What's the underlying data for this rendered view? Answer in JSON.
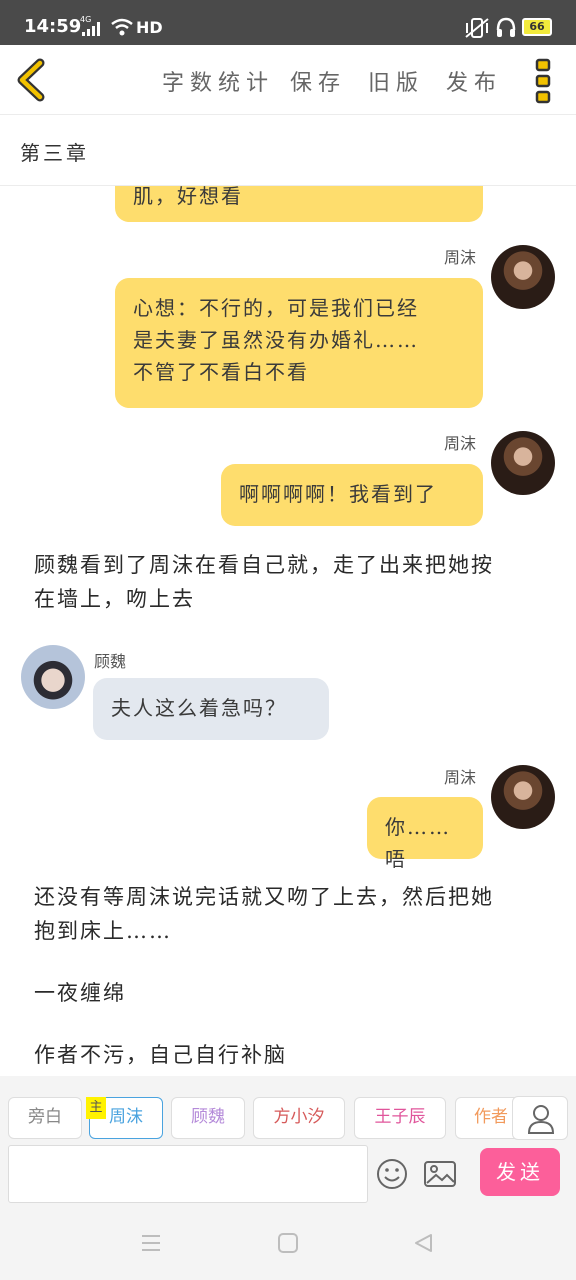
{
  "status_bar": {
    "time": "14:59",
    "network": "4G",
    "quality": "HD",
    "battery": "66"
  },
  "toolbar": {
    "word_count": "字数统计",
    "save": "保存",
    "old_version": "旧版",
    "publish": "发布"
  },
  "chapter": {
    "title": "第三章"
  },
  "messages": [
    {
      "side": "right",
      "sender": "",
      "text": "肌，好想看"
    },
    {
      "side": "right",
      "sender": "周沫",
      "lines": [
        "心想：不行的，可是我们已经",
        "是夫妻了虽然没有办婚礼……",
        "不管了不看白不看"
      ]
    },
    {
      "side": "right",
      "sender": "周沫",
      "text": "啊啊啊啊！我看到了"
    },
    {
      "side": "narration",
      "lines": [
        "顾魏看到了周沫在看自己就，走了出来把她按",
        "在墙上，吻上去"
      ]
    },
    {
      "side": "left",
      "sender": "顾魏",
      "text": "夫人这么着急吗？"
    },
    {
      "side": "right",
      "sender": "周沫",
      "text": "你……唔"
    },
    {
      "side": "narration",
      "lines": [
        "还没有等周沫说完话就又吻了上去，然后把她",
        "抱到床上……"
      ]
    },
    {
      "side": "narration",
      "text": "一夜缠绵"
    },
    {
      "side": "narration",
      "text": "作者不污，自己自行补脑"
    }
  ],
  "roles": [
    {
      "label": "旁白",
      "color": "#888888"
    },
    {
      "label": "周沫",
      "color": "#4aa3df",
      "badge": "主"
    },
    {
      "label": "顾魏",
      "color": "#b48ad9"
    },
    {
      "label": "方小汐",
      "color": "#d65a5a"
    },
    {
      "label": "王子辰",
      "color": "#e0559b"
    },
    {
      "label": "作者",
      "color": "#f29a5c"
    }
  ],
  "input": {
    "value": "",
    "send_label": "发送"
  },
  "colors": {
    "bubble_right": "#fedd6d",
    "bubble_left": "#e3e8ef",
    "send": "#fc5f9a",
    "accent": "#f2c200"
  }
}
